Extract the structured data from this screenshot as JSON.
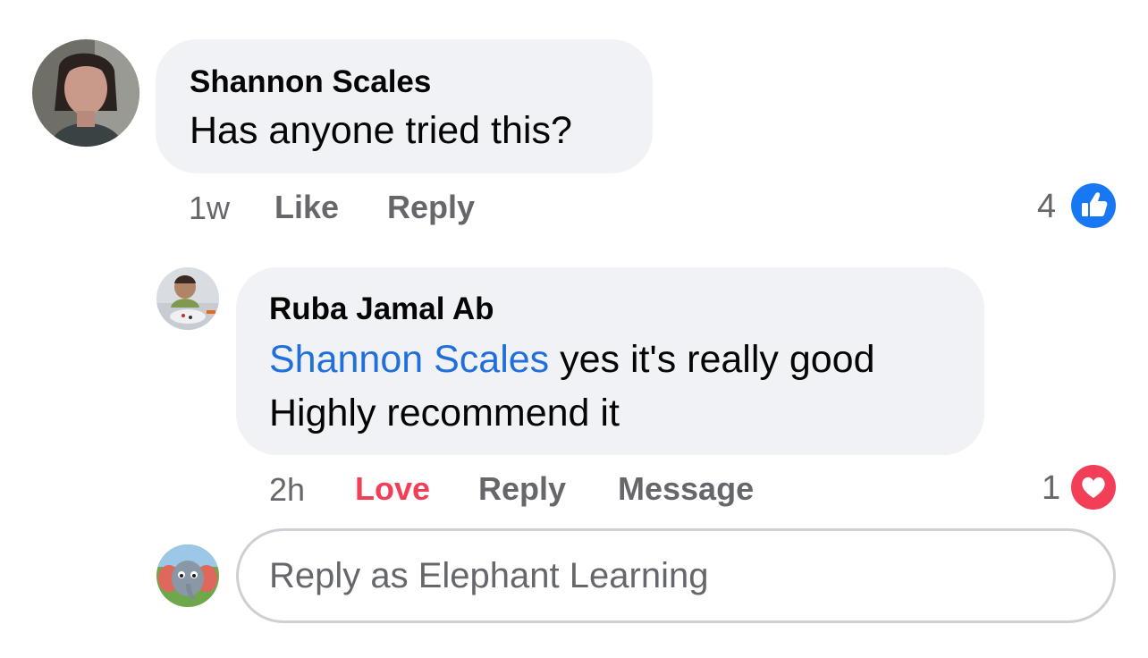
{
  "comment": {
    "author": "Shannon Scales",
    "text": "Has anyone tried this?",
    "time": "1w",
    "like_label": "Like",
    "reply_label": "Reply",
    "reaction_count": "4",
    "reaction_icon": "like-icon"
  },
  "reply": {
    "author": "Ruba Jamal Ab",
    "mention": "Shannon Scales",
    "text_line1": " yes it's really good",
    "text_line2": "Highly recommend it",
    "time": "2h",
    "love_label": "Love",
    "reply_label": "Reply",
    "message_label": "Message",
    "reaction_count": "1",
    "reaction_icon": "love-icon"
  },
  "composer": {
    "placeholder": "Reply as Elephant Learning"
  },
  "colors": {
    "bubble_bg": "#f0f2f5",
    "mention": "#216fdb",
    "love": "#f33e58",
    "like_blue": "#1877f2",
    "meta_gray": "#65676b"
  }
}
